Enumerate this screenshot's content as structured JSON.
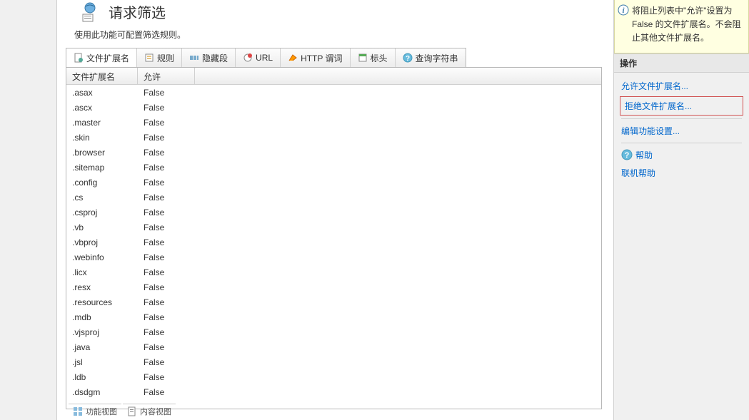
{
  "title": "请求筛选",
  "subtitle": "使用此功能可配置筛选规则。",
  "tabs": [
    {
      "label": "文件扩展名",
      "icon": "file-ext-icon"
    },
    {
      "label": "规则",
      "icon": "rules-icon"
    },
    {
      "label": "隐藏段",
      "icon": "hidden-icon"
    },
    {
      "label": "URL",
      "icon": "url-icon"
    },
    {
      "label": "HTTP 谓词",
      "icon": "http-verb-icon"
    },
    {
      "label": "标头",
      "icon": "header-icon"
    },
    {
      "label": "查询字符串",
      "icon": "query-icon"
    }
  ],
  "columns": {
    "ext": "文件扩展名",
    "allow": "允许"
  },
  "rows": [
    {
      "ext": ".asax",
      "allow": "False"
    },
    {
      "ext": ".ascx",
      "allow": "False"
    },
    {
      "ext": ".master",
      "allow": "False"
    },
    {
      "ext": ".skin",
      "allow": "False"
    },
    {
      "ext": ".browser",
      "allow": "False"
    },
    {
      "ext": ".sitemap",
      "allow": "False"
    },
    {
      "ext": ".config",
      "allow": "False"
    },
    {
      "ext": ".cs",
      "allow": "False"
    },
    {
      "ext": ".csproj",
      "allow": "False"
    },
    {
      "ext": ".vb",
      "allow": "False"
    },
    {
      "ext": ".vbproj",
      "allow": "False"
    },
    {
      "ext": ".webinfo",
      "allow": "False"
    },
    {
      "ext": ".licx",
      "allow": "False"
    },
    {
      "ext": ".resx",
      "allow": "False"
    },
    {
      "ext": ".resources",
      "allow": "False"
    },
    {
      "ext": ".mdb",
      "allow": "False"
    },
    {
      "ext": ".vjsproj",
      "allow": "False"
    },
    {
      "ext": ".java",
      "allow": "False"
    },
    {
      "ext": ".jsl",
      "allow": "False"
    },
    {
      "ext": ".ldb",
      "allow": "False"
    },
    {
      "ext": ".dsdgm",
      "allow": "False"
    }
  ],
  "info_text": "将阻止列表中\"允许\"设置为 False 的文件扩展名。不会阻止其他文件扩展名。",
  "actions_header": "操作",
  "actions": {
    "allow_ext": "允许文件扩展名...",
    "deny_ext": "拒绝文件扩展名...",
    "edit_settings": "编辑功能设置...",
    "help": "帮助",
    "online_help": "联机帮助"
  },
  "bottom_tabs": {
    "features": "功能视图",
    "content": "内容视图"
  }
}
